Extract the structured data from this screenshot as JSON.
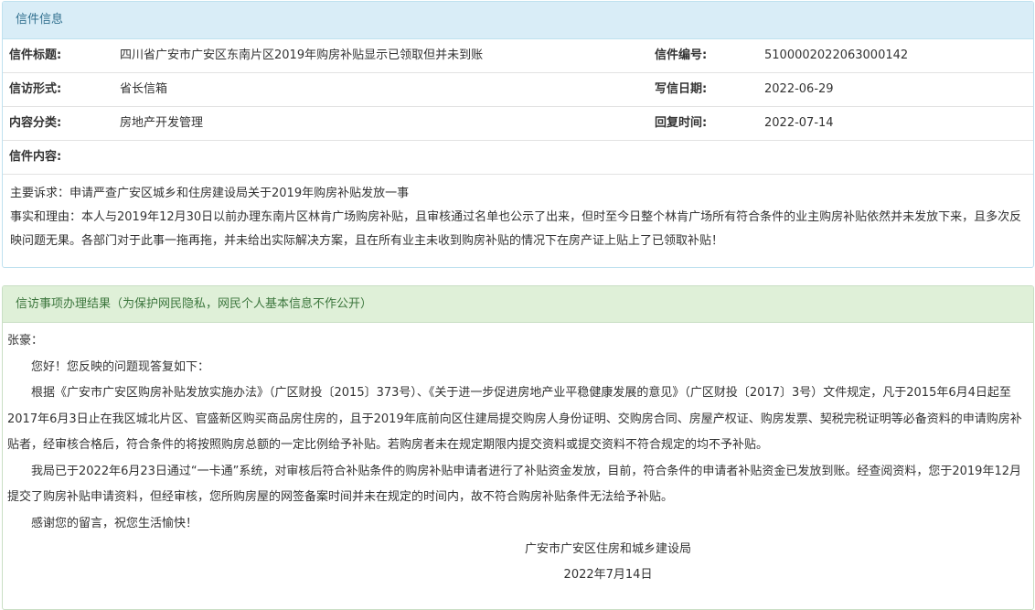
{
  "info_panel": {
    "heading": "信件信息",
    "rows": [
      {
        "label1": "信件标题:",
        "value1": "四川省广安市广安区东南片区2019年购房补贴显示已领取但并未到账",
        "label2": "信件编号:",
        "value2": "5100002022063000142"
      },
      {
        "label1": "信访形式:",
        "value1": "省长信箱",
        "label2": "写信日期:",
        "value2": "2022-06-29"
      },
      {
        "label1": "内容分类:",
        "value1": "房地产开发管理",
        "label2": "回复时间:",
        "value2": "2022-07-14"
      }
    ],
    "content_label": "信件内容:",
    "content_lines": [
      "主要诉求：申请严查广安区城乡和住房建设局关于2019年购房补贴发放一事",
      "事实和理由：本人与2019年12月30日以前办理东南片区林肯广场购房补贴，且审核通过名单也公示了出来，但时至今日整个林肯广场所有符合条件的业主购房补贴依然并未发放下来，且多次反映问题无果。各部门对于此事一拖再拖，并未给出实际解决方案，且在所有业主未收到购房补贴的情况下在房产证上贴上了已领取补贴！"
    ]
  },
  "result_panel": {
    "heading": "信访事项办理结果（为保护网民隐私，网民个人基本信息不作公开）",
    "salutation": "张豪：",
    "paragraphs": [
      "您好！您反映的问题现答复如下：",
      "根据《广安市广安区购房补贴发放实施办法》（广区财投〔2015〕373号）、《关于进一步促进房地产业平稳健康发展的意见》（广区财投〔2017〕3号）文件规定，凡于2015年6月4日起至2017年6月3日止在我区城北片区、官盛新区购买商品房住房的，且于2019年底前向区住建局提交购房人身份证明、交购房合同、房屋产权证、购房发票、契税完税证明等必备资料的申请购房补贴者，经审核合格后，符合条件的将按照购房总额的一定比例给予补贴。若购房者未在规定期限内提交资料或提交资料不符合规定的均不予补贴。",
      "我局已于2022年6月23日通过“一卡通”系统，对审核后符合补贴条件的购房补贴申请者进行了补贴资金发放，目前，符合条件的申请者补贴资金已发放到账。经查阅资料，您于2019年12月提交了购房补贴申请资料，但经审核，您所购房屋的网签备案时间并未在规定的时间内，故不符合购房补贴条件无法给予补贴。",
      "感谢您的留言，祝您生活愉快！"
    ],
    "signature": "广安市广安区住房和城乡建设局",
    "date": "2022年7月14日"
  }
}
